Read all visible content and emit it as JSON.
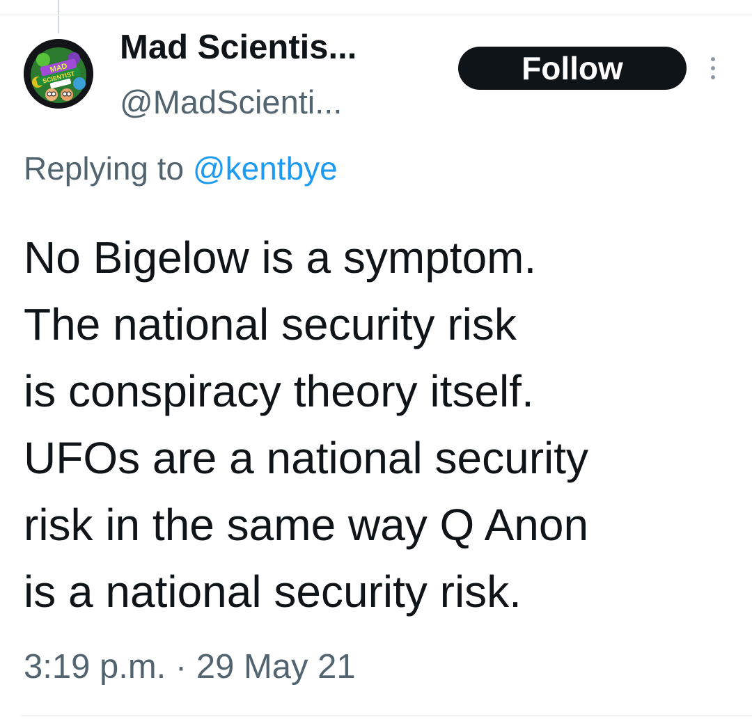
{
  "profile": {
    "display_name": "Mad Scientis...",
    "handle": "@MadScienti...",
    "avatar_icon": "mad-scientist-podcast-logo-icon"
  },
  "actions": {
    "follow_label": "Follow",
    "more_icon": "more-vertical-icon"
  },
  "reply": {
    "prefix": "Replying to ",
    "mention": "@kentbye"
  },
  "tweet": {
    "lines": [
      "No Bigelow is a symptom.",
      "The national security risk",
      "is conspiracy theory itself.",
      "UFOs are a national security",
      "risk in the same way Q Anon",
      "is a national security risk."
    ]
  },
  "timestamp": "3:19 p.m. · 29 May 21",
  "colors": {
    "text_primary": "#0f1419",
    "text_secondary": "#536471",
    "link": "#1d9bf0",
    "button_bg": "#0f1419",
    "button_text": "#ffffff"
  }
}
